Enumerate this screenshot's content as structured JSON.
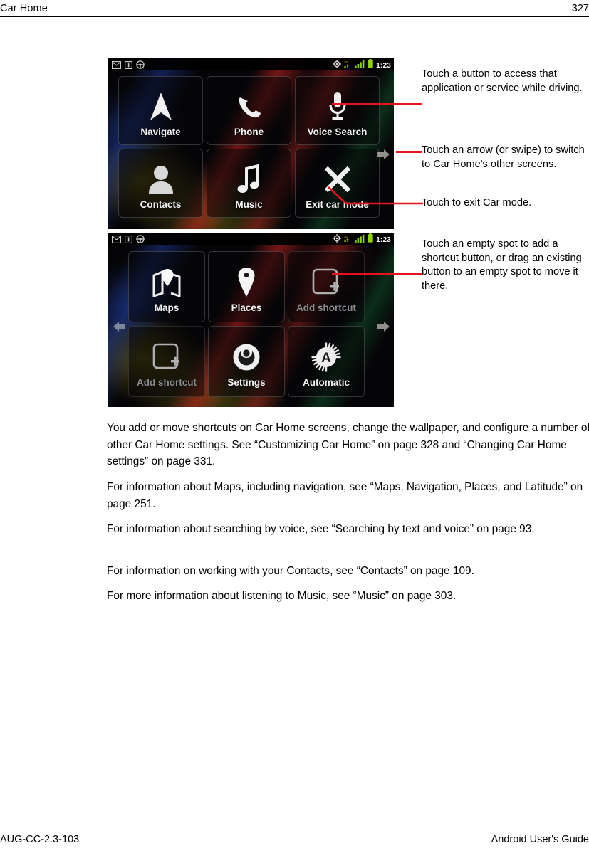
{
  "header": {
    "title": "Car Home",
    "page_number": "327"
  },
  "footer": {
    "doc_code": "AUG-CC-2.3-103",
    "guide_name": "Android User's Guide"
  },
  "screenshot_1": {
    "status_bar": {
      "time": "1:23",
      "left_icons": [
        "mail-icon",
        "notification-icon",
        "car-mode-icon"
      ],
      "right_icons": [
        "gps-icon",
        "data-transfer-icon",
        "signal-bars-icon",
        "battery-icon"
      ]
    },
    "tiles": [
      {
        "label": "Navigate",
        "icon": "navigate-arrow-icon",
        "empty": false
      },
      {
        "label": "Phone",
        "icon": "phone-handset-icon",
        "empty": false
      },
      {
        "label": "Voice Search",
        "icon": "microphone-icon",
        "empty": false
      },
      {
        "label": "Contacts",
        "icon": "person-icon",
        "empty": false
      },
      {
        "label": "Music",
        "icon": "music-note-icon",
        "empty": false
      },
      {
        "label": "Exit car mode",
        "icon": "close-x-icon",
        "empty": false
      }
    ],
    "arrows": {
      "right": "arrow-right-icon"
    }
  },
  "screenshot_2": {
    "status_bar": {
      "time": "1:23",
      "left_icons": [
        "mail-icon",
        "notification-icon",
        "car-mode-icon"
      ],
      "right_icons": [
        "gps-icon",
        "data-transfer-icon",
        "signal-bars-icon",
        "battery-icon"
      ]
    },
    "tiles": [
      {
        "label": "Maps",
        "icon": "map-pin-book-icon",
        "empty": false
      },
      {
        "label": "Places",
        "icon": "place-pin-icon",
        "empty": false
      },
      {
        "label": "Add shortcut",
        "icon": "add-shortcut-icon",
        "empty": true
      },
      {
        "label": "Add shortcut",
        "icon": "add-shortcut-icon",
        "empty": true
      },
      {
        "label": "Settings",
        "icon": "settings-ring-icon",
        "empty": false
      },
      {
        "label": "Automatic",
        "icon": "automatic-a-icon",
        "empty": false
      }
    ],
    "arrows": {
      "left": "arrow-left-icon",
      "right": "arrow-right-icon"
    }
  },
  "callouts": [
    {
      "text": "Touch a button to access that application or service while driving."
    },
    {
      "text": "Touch an arrow (or swipe) to switch to Car Home's other screens."
    },
    {
      "text": "Touch to exit Car mode."
    },
    {
      "text": "Touch an empty spot to add a shortcut button, or drag an existing button to an empty spot to move it there."
    }
  ],
  "body_paragraphs": [
    "You add or move shortcuts on Car Home screens, change the wallpaper, and configure a number of other Car Home settings. See “Customizing Car Home” on page 328 and “Changing Car Home settings” on page 331.",
    "For information about Maps, including navigation, see “Maps, Navigation, Places, and Latitude” on page 251.",
    "For information about searching by voice, see “Searching by text and voice” on page 93.",
    "For information on working with your Contacts, see “Contacts” on page 109.",
    "For more information about listening to Music, see “Music” on page 303."
  ],
  "colors": {
    "leader_red": "#e8121a",
    "battery_green": "#8fd400",
    "page_background": "#ffffff"
  }
}
